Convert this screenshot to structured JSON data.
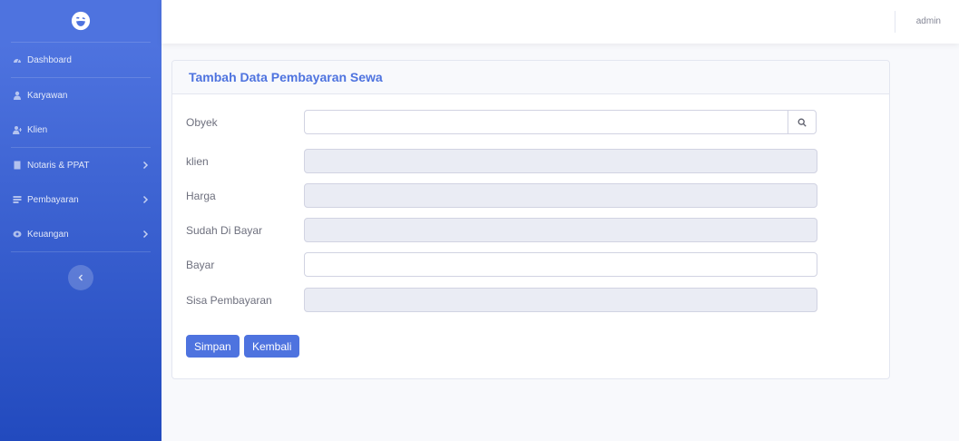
{
  "user": {
    "name": "admin"
  },
  "sidebar": {
    "items": [
      {
        "label": "Dashboard",
        "icon": "dashboard-icon",
        "has_submenu": false
      },
      {
        "label": "Karyawan",
        "icon": "user-icon",
        "has_submenu": false
      },
      {
        "label": "Klien",
        "icon": "user-plus-icon",
        "has_submenu": false
      },
      {
        "label": "Notaris & PPAT",
        "icon": "building-icon",
        "has_submenu": true
      },
      {
        "label": "Pembayaran",
        "icon": "receipt-icon",
        "has_submenu": true
      },
      {
        "label": "Keuangan",
        "icon": "money-icon",
        "has_submenu": true
      }
    ]
  },
  "form": {
    "title": "Tambah Data Pembayaran Sewa",
    "fields": [
      {
        "label": "Obyek",
        "value": "",
        "readonly": false
      },
      {
        "label": "klien",
        "value": "",
        "readonly": true
      },
      {
        "label": "Harga",
        "value": "",
        "readonly": true
      },
      {
        "label": "Sudah Di Bayar",
        "value": "",
        "readonly": true
      },
      {
        "label": "Bayar",
        "value": "",
        "readonly": false
      },
      {
        "label": "Sisa Pembayaran",
        "value": "",
        "readonly": true
      }
    ],
    "buttons": {
      "save": "Simpan",
      "back": "Kembali"
    }
  },
  "colors": {
    "primary": "#4e73df",
    "sidebar_bottom": "#224abe",
    "readonly_bg": "#eaecf4"
  }
}
